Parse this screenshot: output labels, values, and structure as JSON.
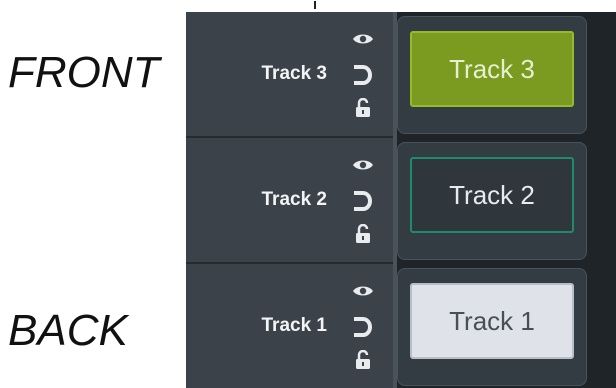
{
  "labels": {
    "front": "FRONT",
    "back": "BACK"
  },
  "tracks": [
    {
      "name": "Track 3",
      "clip_label": "Track 3",
      "clip_style": "green"
    },
    {
      "name": "Track 2",
      "clip_label": "Track 2",
      "clip_style": "dark-outlined"
    },
    {
      "name": "Track 1",
      "clip_label": "Track 1",
      "clip_style": "light"
    }
  ],
  "icons": {
    "visibility": "eye-icon",
    "magnet": "magnet-icon",
    "lock": "lock-icon"
  },
  "colors": {
    "header_bg": "#3b4249",
    "timeline_bg": "#1f2428",
    "clip_green": "#7a9b1f",
    "clip_outline_teal": "#1f8a6e",
    "clip_light": "#dfe3e9"
  }
}
